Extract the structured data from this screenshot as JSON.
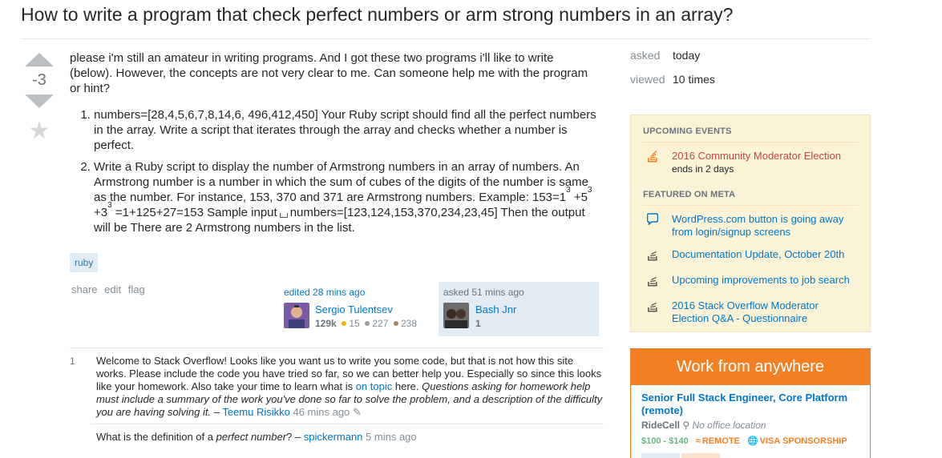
{
  "question": {
    "title": "How to write a program that check perfect numbers or arm strong numbers in an array?",
    "vote_count": "-3",
    "intro": "please i'm still an amateur in writing programs. And I got these two programs i'll like to write (below). However, the concepts are not very clear to me. Can someone help me with the program or hint?",
    "item1": "numbers=[28,4,5,6,7,8,14,6, 496,412,450] Your Ruby script should find all the perfect numbers in the array. Write a script that iterates through the array and checks whether a number is perfect.",
    "item2_a": "Write a Ruby script to display the number of Armstrong numbers in an array of numbers. An Armstrong number is a number in which the sum of cubes of the digits of the number is same as the number. For instance, 153, 370 and 371 are Armstrong numbers. Example: 153=1",
    "item2_b": " +5",
    "item2_c": " +3",
    "item2_d": " =1+125+27=153 Sample input",
    "item2_e": "numbers=[123,124,153,370,234,23,45] Then the output will be There are 2 Armstrong numbers in the list.",
    "sup": "3",
    "tag": "ruby"
  },
  "post_menu": {
    "share": "share",
    "edit": "edit",
    "flag": "flag"
  },
  "edited": {
    "action": "edited 28 mins ago",
    "user": "Sergio Tulentsev",
    "rep": "129k",
    "gold": "15",
    "silver": "227",
    "bronze": "238"
  },
  "asked": {
    "action": "asked 51 mins ago",
    "user": "Bash Jnr",
    "rep": "1"
  },
  "comments": [
    {
      "score": "1",
      "text_a": "Welcome to Stack Overflow! Looks like you want us to write you some code, but that is not how this site works. Please include the code you have tried so far, so we can better help you. Especially so since this looks like your homework. Also take your time to learn what is ",
      "link": "on topic",
      "text_b": " here. ",
      "italic": "Questions asking for homework help must include a summary of the work you've done so far to solve the problem, and a description of the difficulty you are having solving it.",
      "dash": " – ",
      "user": "Teemu Risikko",
      "date": "46 mins ago"
    },
    {
      "text_a": "What is the definition of a ",
      "italic": "perfect number",
      "text_b": "? – ",
      "user": "spickermann",
      "date": "5 mins ago"
    }
  ],
  "stats": {
    "asked_label": "asked",
    "asked_val": "today",
    "viewed_label": "viewed",
    "viewed_val": "10 times"
  },
  "sidebar": {
    "upcoming_header": "UPCOMING EVENTS",
    "event_title": "2016 Community Moderator Election",
    "event_sub": "ends in 2 days",
    "featured_header": "FEATURED ON META",
    "meta_items": [
      "WordPress.com button is going away from login/signup screens",
      "Documentation Update, October 20th",
      "Upcoming improvements to job search",
      "2016 Stack Overflow Moderator Election Q&A - Questionnaire"
    ]
  },
  "job": {
    "header": "Work from anywhere",
    "title": "Senior Full Stack Engineer, Core Platform (remote)",
    "company": "RideCell",
    "location": "No office location",
    "salary": "$100 - $140",
    "remote": "REMOTE",
    "visa": "VISA SPONSORSHIP"
  },
  "colors": {
    "accent": "#0077cc",
    "orange": "#f48024",
    "tag_bg": "#e1ecf4",
    "notice_bg": "#fbf3d5"
  },
  "icons": [
    "vote-up-icon",
    "vote-down-icon",
    "favorite-star-icon",
    "stack-exchange-icon",
    "chat-bubble-icon",
    "stack-overflow-icon",
    "location-pin-icon",
    "remote-wifi-icon",
    "globe-icon",
    "pencil-icon"
  ]
}
